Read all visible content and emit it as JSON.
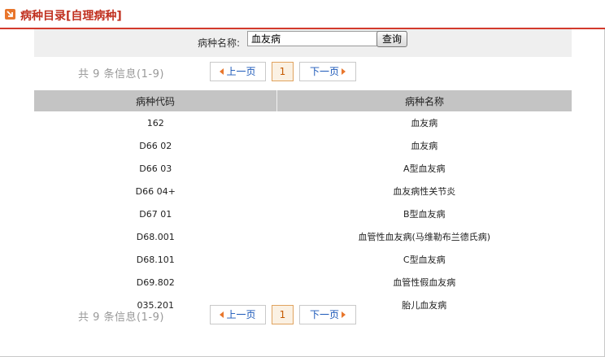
{
  "header": {
    "title": "病种目录[自理病种]",
    "icon": "arrow-down-right-icon"
  },
  "search": {
    "label": "病种名称:",
    "value": "血友病",
    "button": "查询"
  },
  "pager": {
    "info": "共 9 条信息(1-9)",
    "prev": "上一页",
    "current": "1",
    "next": "下一页"
  },
  "table": {
    "headers": [
      "病种代码",
      "病种名称"
    ],
    "rows": [
      [
        "162",
        "血友病"
      ],
      [
        "D66 02",
        "血友病"
      ],
      [
        "D66 03",
        "A型血友病"
      ],
      [
        "D66 04+",
        "血友病性关节炎"
      ],
      [
        "D67 01",
        "B型血友病"
      ],
      [
        "D68.001",
        "血管性血友病(马维勒布兰德氏病)"
      ],
      [
        "D68.101",
        "C型血友病"
      ],
      [
        "D69.802",
        "血管性假血友病"
      ],
      [
        "035.201",
        "胎儿血友病"
      ]
    ]
  },
  "colors": {
    "accent": "#d33a2c",
    "icon": "#e8762c",
    "link": "#1a57b8",
    "header_bg": "#c4c4c4"
  }
}
